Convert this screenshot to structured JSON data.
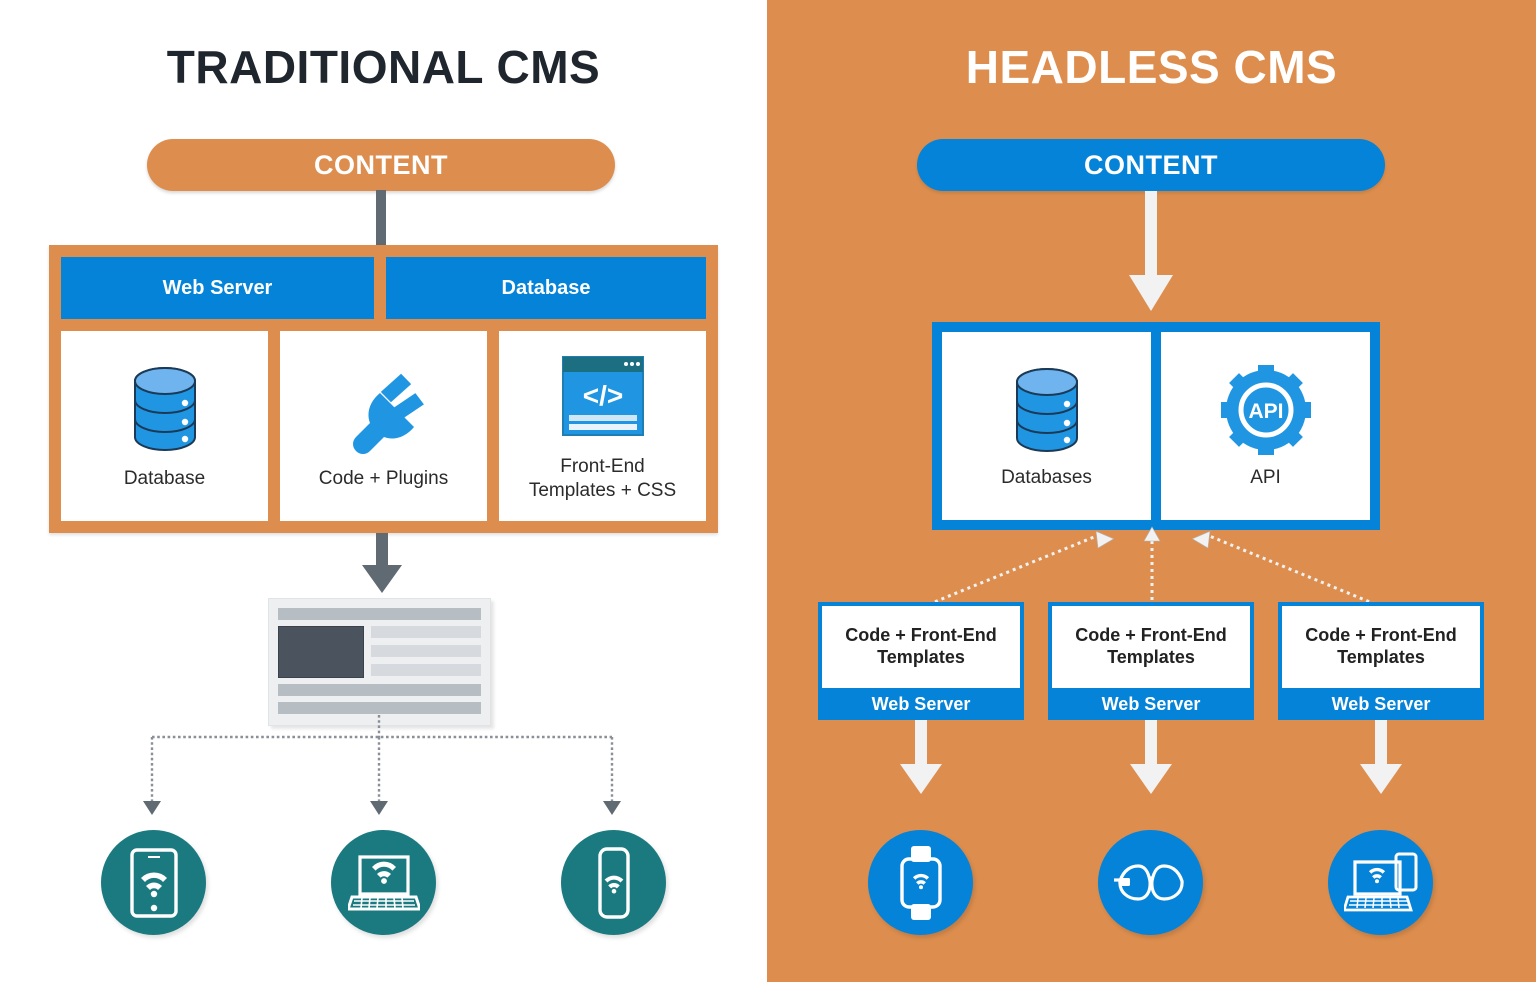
{
  "colors": {
    "orange": "#DD8E4E",
    "blue": "#0583D8",
    "teal": "#1B7A80",
    "dark_text": "#20262E",
    "white": "#FFFFFF",
    "grey_arrow": "#5F6A72"
  },
  "left_panel": {
    "title": "TRADITIONAL CMS",
    "content_label": "CONTENT",
    "header_cells": [
      {
        "label": "Web Server",
        "icon": "web-server-header"
      },
      {
        "label": "Database",
        "icon": "database-header"
      }
    ],
    "cards": [
      {
        "label": "Database",
        "icon": "database-cylinder-icon"
      },
      {
        "label": "Code + Plugins",
        "icon": "plug-icon"
      },
      {
        "label": "Front-End\nTemplates + CSS",
        "label_line1": "Front-End",
        "label_line2": "Templates + CSS",
        "icon": "code-window-icon"
      }
    ],
    "page_mockup": {
      "icon": "rendered-page-mockup"
    },
    "devices": [
      {
        "icon": "tablet-wifi-icon",
        "name": "tablet"
      },
      {
        "icon": "laptop-wifi-icon",
        "name": "laptop"
      },
      {
        "icon": "phone-wifi-icon",
        "name": "phone"
      }
    ]
  },
  "right_panel": {
    "title": "HEADLESS CMS",
    "content_label": "CONTENT",
    "cards": [
      {
        "label": "Databases",
        "icon": "database-cylinder-icon"
      },
      {
        "label": "API",
        "icon": "api-gear-icon",
        "gear_text": "API"
      }
    ],
    "servers": [
      {
        "top_line1": "Code + Front-End",
        "top_line2": "Templates",
        "bottom": "Web Server"
      },
      {
        "top_line1": "Code + Front-End",
        "top_line2": "Templates",
        "bottom": "Web Server"
      },
      {
        "top_line1": "Code + Front-End",
        "top_line2": "Templates",
        "bottom": "Web Server"
      }
    ],
    "devices": [
      {
        "icon": "smartwatch-wifi-icon",
        "name": "smartwatch"
      },
      {
        "icon": "smart-glasses-icon",
        "name": "smart-glasses"
      },
      {
        "icon": "laptop-tablet-wifi-icon",
        "name": "laptop-and-tablet"
      }
    ]
  }
}
